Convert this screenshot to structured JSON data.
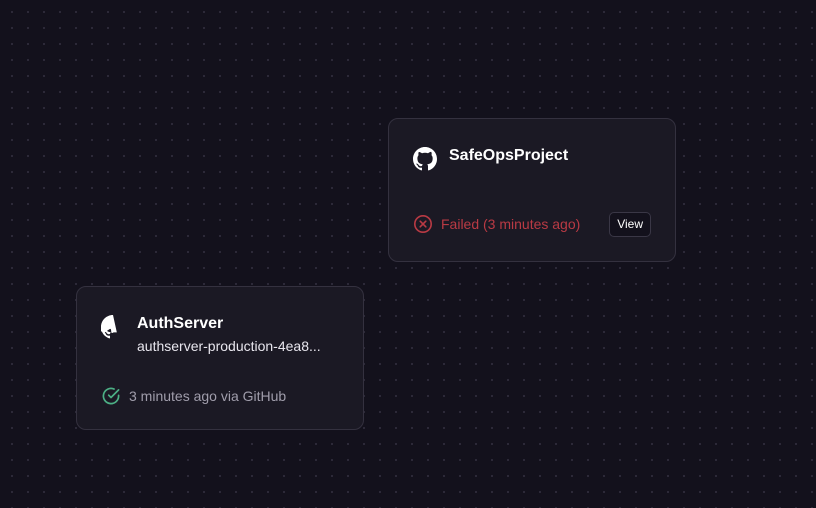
{
  "projects": [
    {
      "name": "SafeOpsProject",
      "icon": "github-icon",
      "status_text": "Failed (3 minutes ago)",
      "status_icon": "error-circle-icon",
      "status_color": "#b93a44",
      "view_label": "View"
    },
    {
      "name": "AuthServer",
      "icon": "github-icon",
      "domain": "authserver-production-4ea8...",
      "status_text": "3 minutes ago via GitHub",
      "status_icon": "check-circle-icon",
      "status_color": "#4caf85"
    }
  ],
  "colors": {
    "background": "#13111c",
    "card": "#1b1924",
    "card_border": "#34313f",
    "failed": "#b93a44",
    "success": "#4caf85"
  }
}
